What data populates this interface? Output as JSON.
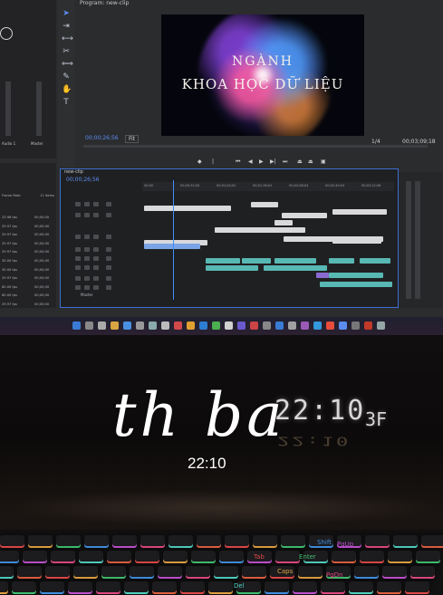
{
  "editor": {
    "program_label": "Program: new-clip",
    "video_title_line1": "NGÀNH",
    "video_title_line2": "KHOA HỌC DỮ LIỆU",
    "program_timecode": "00;00;26;56",
    "program_fit": "Fit",
    "program_duration": "00;03;09;18",
    "program_scale": "1/4",
    "sequence_tab": "new-clip",
    "sequence_timecode": "00;00;26;56",
    "ruler_ticks": [
      "00;00",
      "00;00;32;00",
      "00;01;04;02",
      "00;01;36;02",
      "00;02;08;04",
      "00;02;40;04",
      "00;03;12;06"
    ],
    "left_panel_header": [
      "Frame Rate",
      "Media St"
    ],
    "left_panel_count": "11 items",
    "left_panel_rows": [
      [
        "23.98 fps",
        "00;00;00"
      ],
      [
        "29.97 fps",
        "00;00;00"
      ],
      [
        "29.97 fps",
        "00;00;00"
      ],
      [
        "29.97 fps",
        "00;00;00"
      ],
      [
        "29.97 fps",
        "00;00;00"
      ],
      [
        "30.00 fps",
        "00;00;00"
      ],
      [
        "30.00 fps",
        "00;00;00"
      ],
      [
        "29.97 fps",
        "00;00;00"
      ],
      [
        "60.00 fps",
        "00;00;00"
      ],
      [
        "60.00 fps",
        "00;00;00"
      ],
      [
        "29.97 fps",
        "00;00;00"
      ]
    ],
    "audio_labels": [
      "Audio 1",
      "Master"
    ],
    "track_names": [
      "V3",
      "V2",
      "V1",
      "A1",
      "A2",
      "A3",
      "Master"
    ]
  },
  "desk": {
    "clock_time": "22:10",
    "clock_date": "3F",
    "overlay_day": "th ba",
    "overlay_time": "22:10"
  },
  "keyboard": {
    "visible_keys": [
      "Tab",
      "Caps",
      "Enter",
      "Shift",
      "PgUp",
      "PgDn",
      "Del"
    ]
  },
  "colors": {
    "accent_blue": "#3d6fd1",
    "clip_teal": "#58b8b4",
    "clip_gray": "#d9d9db",
    "overlay_text": "#ffffff"
  }
}
